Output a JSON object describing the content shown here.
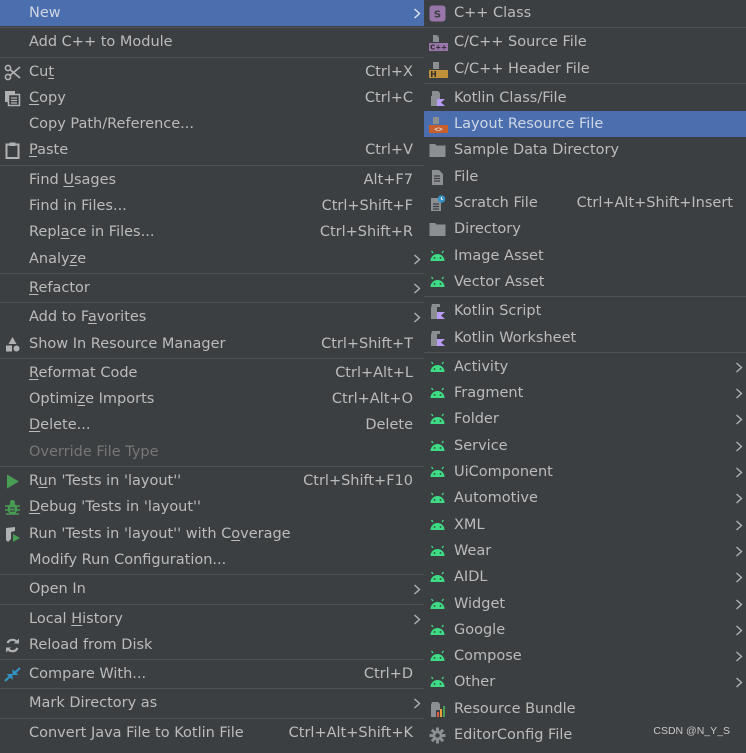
{
  "main_menu": {
    "items": [
      {
        "label": "New",
        "selected": true,
        "submenu": true
      },
      {
        "sep": true
      },
      {
        "label": "Add C++ to Module"
      },
      {
        "sep": true
      },
      {
        "label": "Cut",
        "underline": "t",
        "underline_index": 2,
        "shortcut": "Ctrl+X",
        "icon": "scissors-icon"
      },
      {
        "label": "Copy",
        "underline_index": 0,
        "shortcut": "Ctrl+C",
        "icon": "copy-icon"
      },
      {
        "label": "Copy Path/Reference..."
      },
      {
        "label": "Paste",
        "underline_index": 0,
        "shortcut": "Ctrl+V",
        "icon": "clipboard-icon"
      },
      {
        "sep": true
      },
      {
        "label": "Find Usages",
        "underline_index": 5,
        "shortcut": "Alt+F7"
      },
      {
        "label": "Find in Files...",
        "shortcut": "Ctrl+Shift+F"
      },
      {
        "label": "Replace in Files...",
        "underline_index": 4,
        "shortcut": "Ctrl+Shift+R"
      },
      {
        "label": "Analyze",
        "underline_index": 5,
        "submenu": true
      },
      {
        "sep": true
      },
      {
        "label": "Refactor",
        "underline_index": 0,
        "submenu": true
      },
      {
        "sep": true
      },
      {
        "label": "Add to Favorites",
        "underline_index": 8,
        "submenu": true
      },
      {
        "label": "Show In Resource Manager",
        "shortcut": "Ctrl+Shift+T",
        "icon": "shapes-icon"
      },
      {
        "sep": true
      },
      {
        "label": "Reformat Code",
        "underline_index": 0,
        "shortcut": "Ctrl+Alt+L"
      },
      {
        "label": "Optimize Imports",
        "underline_index": 6,
        "shortcut": "Ctrl+Alt+O"
      },
      {
        "label": "Delete...",
        "underline_index": 0,
        "shortcut": "Delete"
      },
      {
        "label": "Override File Type",
        "disabled": true
      },
      {
        "sep": true
      },
      {
        "label": "Run 'Tests in 'layout''",
        "underline_index": 1,
        "shortcut": "Ctrl+Shift+F10",
        "icon": "run-icon"
      },
      {
        "label": "Debug 'Tests in 'layout''",
        "underline_index": 0,
        "icon": "debug-bug-icon"
      },
      {
        "label": "Run 'Tests in 'layout'' with Coverage",
        "underline_index": 30,
        "icon": "coverage-icon"
      },
      {
        "label": "Modify Run Configuration..."
      },
      {
        "sep": true
      },
      {
        "label": "Open In",
        "submenu": true
      },
      {
        "sep": true
      },
      {
        "label": "Local History",
        "underline_index": 6,
        "submenu": true
      },
      {
        "label": "Reload from Disk",
        "icon": "reload-icon"
      },
      {
        "sep": true
      },
      {
        "label": "Compare With...",
        "shortcut": "Ctrl+D",
        "icon": "compare-icon"
      },
      {
        "sep": true
      },
      {
        "label": "Mark Directory as",
        "submenu": true
      },
      {
        "sep": true
      },
      {
        "label": "Convert Java File to Kotlin File",
        "shortcut": "Ctrl+Alt+Shift+K"
      }
    ]
  },
  "sub_menu": {
    "items": [
      {
        "label": "C++ Class",
        "icon": "cpp-class-icon"
      },
      {
        "sep": true
      },
      {
        "label": "C/C++ Source File",
        "icon": "cpp-source-file-icon"
      },
      {
        "label": "C/C++ Header File",
        "icon": "cpp-header-file-icon"
      },
      {
        "sep": true
      },
      {
        "label": "Kotlin Class/File",
        "icon": "kotlin-file-icon"
      },
      {
        "label": "Layout Resource File",
        "icon": "layout-file-icon",
        "selected": true
      },
      {
        "label": "Sample Data Directory",
        "icon": "folder-icon"
      },
      {
        "label": "File",
        "icon": "file-icon"
      },
      {
        "label": "Scratch File",
        "shortcut": "Ctrl+Alt+Shift+Insert",
        "icon": "scratch-file-icon"
      },
      {
        "label": "Directory",
        "icon": "folder-icon"
      },
      {
        "label": "Image Asset",
        "icon": "android-icon"
      },
      {
        "label": "Vector Asset",
        "icon": "android-icon"
      },
      {
        "sep": true
      },
      {
        "label": "Kotlin Script",
        "icon": "kotlin-script-icon"
      },
      {
        "label": "Kotlin Worksheet",
        "icon": "kotlin-script-icon"
      },
      {
        "sep": true
      },
      {
        "label": "Activity",
        "icon": "android-icon",
        "submenu": true
      },
      {
        "label": "Fragment",
        "icon": "android-icon",
        "submenu": true
      },
      {
        "label": "Folder",
        "icon": "android-icon",
        "submenu": true
      },
      {
        "label": "Service",
        "icon": "android-icon",
        "submenu": true
      },
      {
        "label": "UiComponent",
        "icon": "android-icon",
        "submenu": true
      },
      {
        "label": "Automotive",
        "icon": "android-icon",
        "submenu": true
      },
      {
        "label": "XML",
        "icon": "android-icon",
        "submenu": true
      },
      {
        "label": "Wear",
        "icon": "android-icon",
        "submenu": true
      },
      {
        "label": "AIDL",
        "icon": "android-icon",
        "submenu": true
      },
      {
        "label": "Widget",
        "icon": "android-icon",
        "submenu": true
      },
      {
        "label": "Google",
        "icon": "android-icon",
        "submenu": true
      },
      {
        "label": "Compose",
        "icon": "android-icon",
        "submenu": true
      },
      {
        "label": "Other",
        "icon": "android-icon",
        "submenu": true
      },
      {
        "label": "Resource Bundle",
        "icon": "resource-bundle-icon"
      },
      {
        "label": "EditorConfig File",
        "icon": "gear-icon"
      }
    ]
  },
  "watermark": "CSDN @N_Y_S",
  "colors": {
    "background": "#3c3f41",
    "selection": "#4b6eaf",
    "text": "#bbbbbb",
    "disabled_text": "#777777",
    "separator": "#515151",
    "android_green": "#3ddc84",
    "run_green": "#499c54",
    "compare_blue": "#3592c4"
  }
}
